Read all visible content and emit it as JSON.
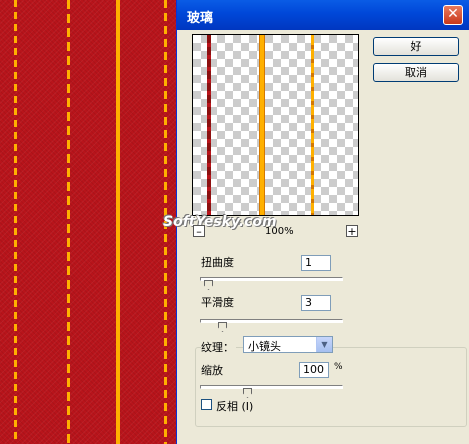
{
  "dialog": {
    "title": "玻璃",
    "ok_label": "好",
    "cancel_label": "取消",
    "zoom_out": "–",
    "zoom_in": "+",
    "zoom_level": "100%",
    "watermark": "SoftYesky.com"
  },
  "fields": {
    "distortion": {
      "label": "扭曲度",
      "value": "1",
      "level": 0.0
    },
    "smoothness": {
      "label": "平滑度",
      "value": "3",
      "level": 0.13
    },
    "texture": {
      "label": "纹理：",
      "value": "小镜头"
    },
    "scaling": {
      "label": "缩放",
      "value": "100",
      "unit": "%",
      "level": 0.3
    },
    "invert": {
      "label": "反相 (I)",
      "checked": false
    }
  },
  "colors": {
    "background_red": "#b8141b",
    "stripe_gold": "#ffb000",
    "stripe_dark": "#8c1010",
    "titlebar": "#0047d8"
  }
}
